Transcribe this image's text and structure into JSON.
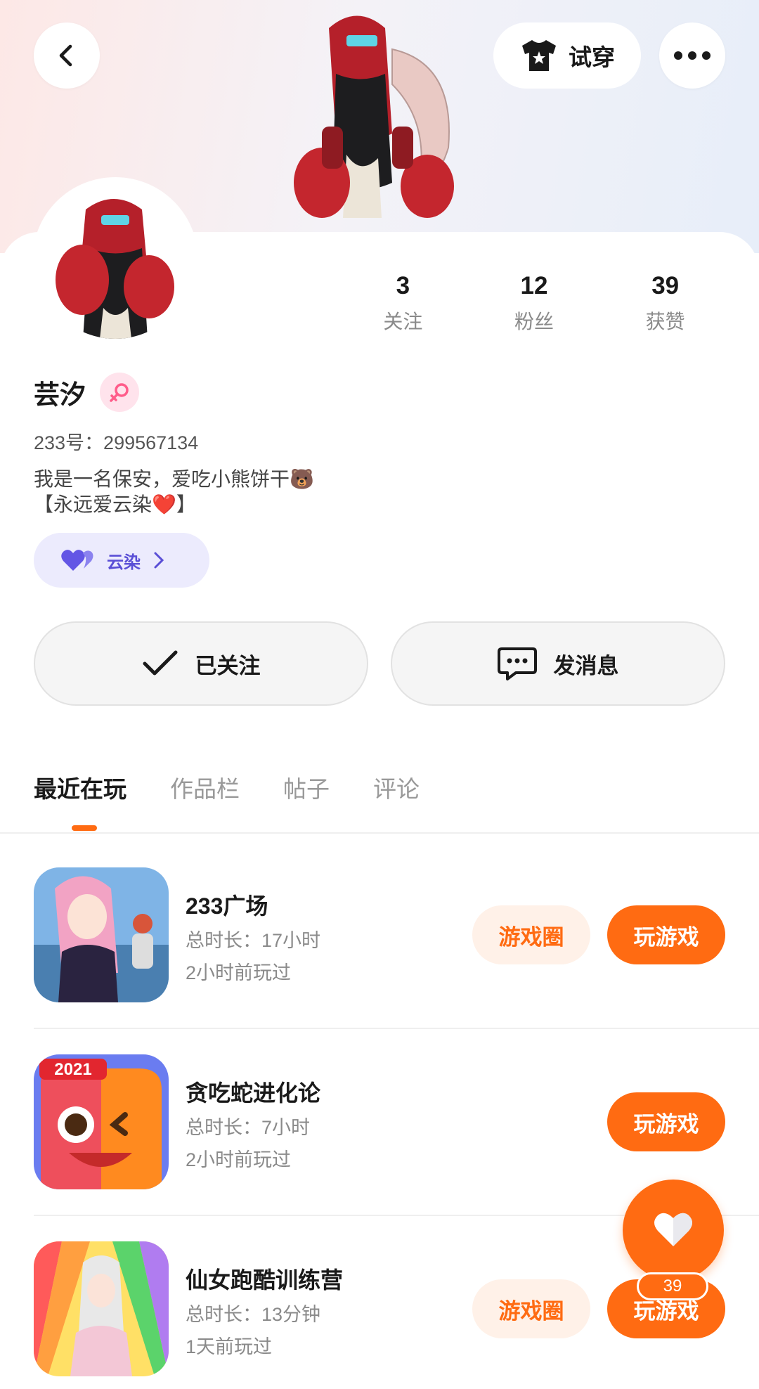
{
  "header": {
    "back_icon": "chevron-left-icon",
    "tryon_label": "试穿",
    "more_icon": "more-horizontal-icon"
  },
  "profile": {
    "name": "芸汐",
    "gender_icon": "female-icon",
    "uid": "233号：299567134",
    "bio_line1": "我是一名保安，爱吃小熊饼干🐻",
    "bio_line2": "【永远爱云染❤️】",
    "tag_label": "云染"
  },
  "stats": [
    {
      "value": "3",
      "label": "关注"
    },
    {
      "value": "12",
      "label": "粉丝"
    },
    {
      "value": "39",
      "label": "获赞"
    }
  ],
  "actions": {
    "follow_label": "已关注",
    "message_label": "发消息"
  },
  "tabs": [
    {
      "label": "最近在玩",
      "active": true
    },
    {
      "label": "作品栏",
      "active": false
    },
    {
      "label": "帖子",
      "active": false
    },
    {
      "label": "评论",
      "active": false
    }
  ],
  "games": [
    {
      "title": "233广场",
      "duration": "总时长：17小时",
      "last_played": "2小时前玩过",
      "circle_label": "游戏圈",
      "play_label": "玩游戏"
    },
    {
      "title": "贪吃蛇进化论",
      "duration": "总时长：7小时",
      "last_played": "2小时前玩过",
      "icon_badge": "2021",
      "play_label": "玩游戏"
    },
    {
      "title": "仙女跑酷训练营",
      "duration": "总时长：13分钟",
      "last_played": "1天前玩过",
      "circle_label": "游戏圈",
      "play_label": "玩游戏"
    }
  ],
  "fab": {
    "icon": "heart-icon",
    "count": "39"
  },
  "colors": {
    "accent": "#ff6b12",
    "accent_light": "#fff1e8",
    "tag_bg": "#ecebfd",
    "tag_text": "#5a4fd6"
  }
}
